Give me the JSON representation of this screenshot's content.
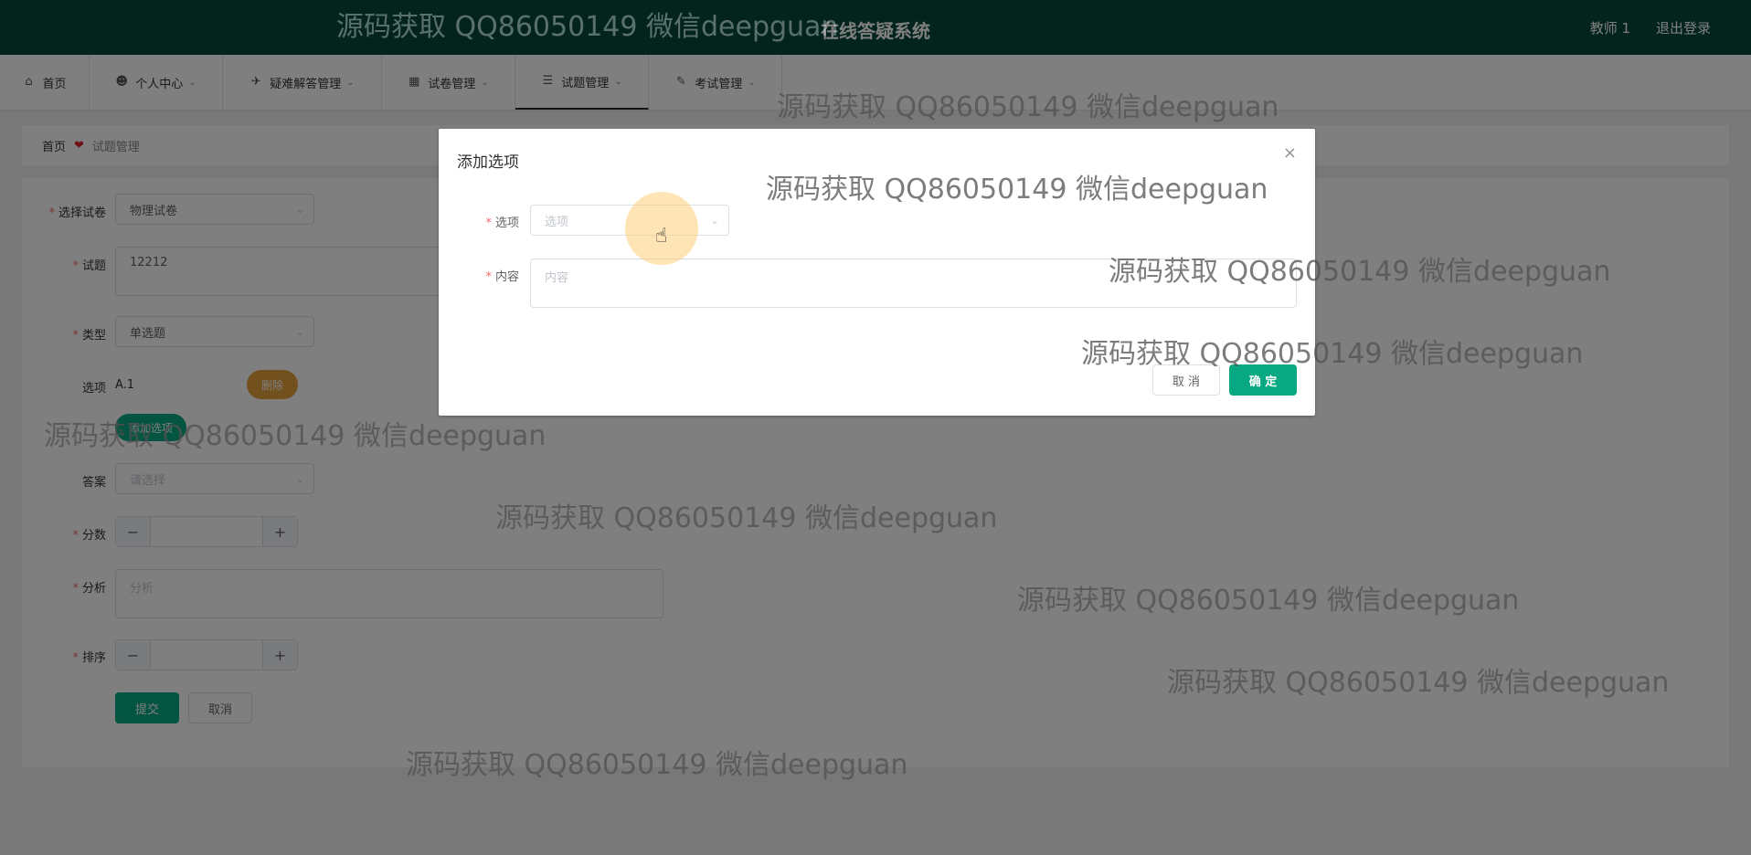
{
  "header": {
    "title": "在线答疑系统",
    "user": "教师 1",
    "logout": "退出登录"
  },
  "nav": {
    "items": [
      {
        "label": "首页",
        "icon": "⌂",
        "dropdown": false
      },
      {
        "label": "个人中心",
        "icon": "☻",
        "dropdown": true
      },
      {
        "label": "疑难解答管理",
        "icon": "✈",
        "dropdown": true
      },
      {
        "label": "试卷管理",
        "icon": "▦",
        "dropdown": true
      },
      {
        "label": "试题管理",
        "icon": "☰",
        "dropdown": true
      },
      {
        "label": "考试管理",
        "icon": "✎",
        "dropdown": true
      }
    ]
  },
  "breadcrumb": {
    "home": "首页",
    "current": "试题管理"
  },
  "form": {
    "paper": {
      "label": "选择试卷",
      "value": "物理试卷"
    },
    "question": {
      "label": "试题",
      "value": "12212"
    },
    "type": {
      "label": "类型",
      "value": "单选题"
    },
    "options": {
      "label": "选项",
      "value": "A.1",
      "delete": "删除",
      "add": "添加选项"
    },
    "answer": {
      "label": "答案",
      "placeholder": "请选择"
    },
    "score": {
      "label": "分数",
      "minus": "−",
      "plus": "+"
    },
    "analysis": {
      "label": "分析",
      "placeholder": "分析"
    },
    "sort": {
      "label": "排序",
      "minus": "−",
      "plus": "+"
    },
    "submit": "提交",
    "cancel": "取消"
  },
  "dialog": {
    "title": "添加选项",
    "close": "×",
    "option": {
      "label": "选项",
      "placeholder": "选项"
    },
    "content": {
      "label": "内容",
      "placeholder": "内容"
    },
    "cancel": "取 消",
    "confirm": "确 定"
  },
  "watermark": "源码获取 QQ86050149 微信deepguan"
}
